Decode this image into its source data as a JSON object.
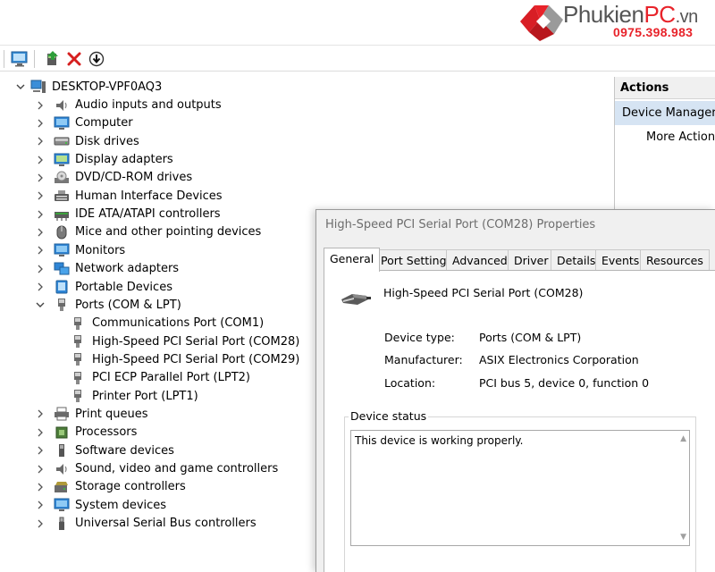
{
  "logo": {
    "brand_a": "Phukien",
    "brand_b": "PC",
    "brand_c": ".vn",
    "phone": "0975.398.983"
  },
  "tree": {
    "root": "DESKTOP-VPF0AQ3",
    "items": [
      {
        "label": "Audio inputs and outputs",
        "icon": "speaker-icon"
      },
      {
        "label": "Computer",
        "icon": "monitor-icon"
      },
      {
        "label": "Disk drives",
        "icon": "disk-icon"
      },
      {
        "label": "Display adapters",
        "icon": "display-adapter-icon"
      },
      {
        "label": "DVD/CD-ROM drives",
        "icon": "dvd-icon"
      },
      {
        "label": "Human Interface Devices",
        "icon": "hid-icon"
      },
      {
        "label": "IDE ATA/ATAPI controllers",
        "icon": "ide-icon"
      },
      {
        "label": "Mice and other pointing devices",
        "icon": "mouse-icon"
      },
      {
        "label": "Monitors",
        "icon": "monitor-icon"
      },
      {
        "label": "Network adapters",
        "icon": "network-icon"
      },
      {
        "label": "Portable Devices",
        "icon": "portable-icon"
      },
      {
        "label": "Ports (COM & LPT)",
        "icon": "port-icon"
      },
      {
        "label": "Print queues",
        "icon": "printer-icon"
      },
      {
        "label": "Processors",
        "icon": "cpu-icon"
      },
      {
        "label": "Software devices",
        "icon": "software-icon"
      },
      {
        "label": "Sound, video and game controllers",
        "icon": "speaker-icon"
      },
      {
        "label": "Storage controllers",
        "icon": "storage-icon"
      },
      {
        "label": "System devices",
        "icon": "system-icon"
      },
      {
        "label": "Universal Serial Bus controllers",
        "icon": "usb-icon"
      }
    ],
    "ports_children": [
      "Communications Port (COM1)",
      "High-Speed PCI Serial Port (COM28)",
      "High-Speed PCI Serial Port (COM29)",
      "PCI ECP Parallel Port (LPT2)",
      "Printer Port (LPT1)"
    ]
  },
  "actions": {
    "header": "Actions",
    "device_manager": "Device Manager",
    "more": "More Actions"
  },
  "dialog": {
    "title": "High-Speed PCI Serial Port (COM28) Properties",
    "tabs": [
      "General",
      "Port Settings",
      "Advanced",
      "Driver",
      "Details",
      "Events",
      "Resources"
    ],
    "device_name": "High-Speed PCI Serial Port (COM28)",
    "props": [
      {
        "label": "Device type:",
        "value": "Ports (COM & LPT)"
      },
      {
        "label": "Manufacturer:",
        "value": "ASIX Electronics Corporation"
      },
      {
        "label": "Location:",
        "value": "PCI bus 5, device 0, function 0"
      }
    ],
    "status_label": "Device status",
    "status_text": "This device is working properly."
  },
  "colors": {
    "brand_red": "#e8232a",
    "selection": "#d6e4f3",
    "dialog_bg": "#f0f0f0"
  }
}
